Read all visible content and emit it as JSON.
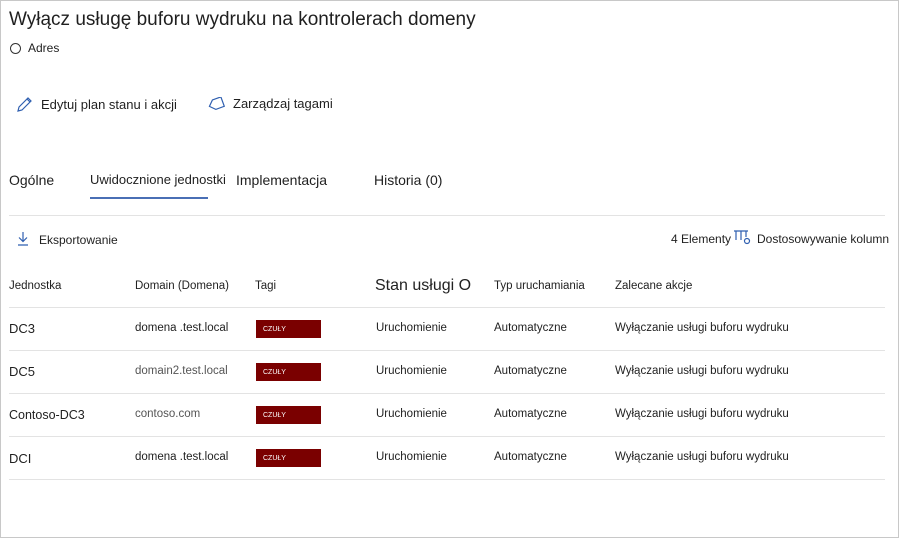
{
  "header": {
    "title": "Wyłącz usługę buforu wydruku na kontrolerach domeny",
    "address_label": "Adres"
  },
  "actions": {
    "edit_label": "Edytuj plan stanu i akcji",
    "tags_label": "Zarządzaj tagami"
  },
  "tabs": [
    {
      "label": "Ogólne"
    },
    {
      "label": "Uwidocznione jednostki"
    },
    {
      "label": "Implementacja"
    },
    {
      "label": "Historia (0)"
    }
  ],
  "toolbar": {
    "export_label": "Eksportowanie",
    "count_label": "4 Elementy",
    "customize_label": "Dostosowywanie kolumn"
  },
  "table": {
    "columns": [
      "Jednostka",
      "Domain (Domena)",
      "Tagi",
      "Stan usługi O",
      "Typ uruchamiania",
      "Zalecane akcje"
    ],
    "rows": [
      {
        "entity": "DC3",
        "domain": "domena .test.local",
        "tag": "CZUŁY",
        "state": "Uruchomienie",
        "startup": "Automatyczne",
        "action": "Wyłączanie usługi buforu wydruku"
      },
      {
        "entity": "DC5",
        "domain": "domain2.test.local",
        "tag": "CZUŁY",
        "state": "Uruchomienie",
        "startup": "Automatyczne",
        "action": "Wyłączanie usługi buforu wydruku"
      },
      {
        "entity": "Contoso-DC3",
        "domain": "contoso.com",
        "tag": "CZUŁY",
        "state": "Uruchomienie",
        "startup": "Automatyczne",
        "action": "Wyłączanie usługi buforu wydruku"
      },
      {
        "entity": "DCI",
        "domain": "domena .test.local",
        "tag": "CZUŁY",
        "state": "Uruchomienie",
        "startup": "Automatyczne",
        "action": "Wyłączanie usługi buforu wydruku"
      }
    ]
  },
  "colors": {
    "accent": "#4a6fb5",
    "tag_background": "#7a0000"
  }
}
